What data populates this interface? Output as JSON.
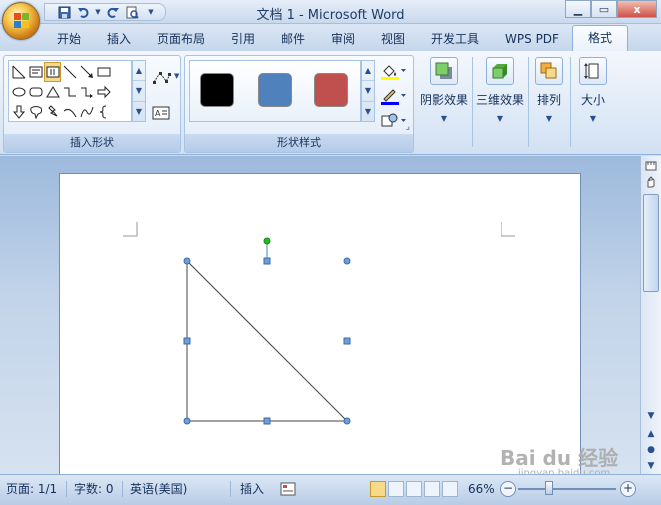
{
  "window": {
    "title": "文档 1 - Microsoft Word",
    "minimize_icon": "minimize-icon",
    "maximize_icon": "maximize-icon",
    "close_label": "x"
  },
  "quick_access": {
    "items": [
      "save-icon",
      "undo-icon",
      "redo-icon",
      "print-preview-icon",
      "customize-dropdown-icon"
    ]
  },
  "tabs": [
    {
      "label": "开始",
      "active": false
    },
    {
      "label": "插入",
      "active": false
    },
    {
      "label": "页面布局",
      "active": false
    },
    {
      "label": "引用",
      "active": false
    },
    {
      "label": "邮件",
      "active": false
    },
    {
      "label": "审阅",
      "active": false
    },
    {
      "label": "视图",
      "active": false
    },
    {
      "label": "开发工具",
      "active": false
    },
    {
      "label": "WPS PDF",
      "active": false
    },
    {
      "label": "格式",
      "active": true
    }
  ],
  "ribbon": {
    "insert_shapes": {
      "label": "插入形状",
      "shapes": [
        "line",
        "textbox",
        "vertical-textbox",
        "line",
        "arrow",
        "rectangle",
        "oval",
        "rounded-rectangle",
        "triangle",
        "elbow-connector",
        "elbow-arrow",
        "right-arrow",
        "down-arrow",
        "callout",
        "lightning",
        "arc",
        "curve",
        "brace"
      ]
    },
    "shape_styles": {
      "label": "形状样式",
      "swatches": [
        "#000000",
        "#4f81bd",
        "#c0504d"
      ],
      "fill_color": "#ffff00",
      "line_color": "#0000ff"
    },
    "shadow_effects": {
      "label": "阴影效果"
    },
    "effects_3d": {
      "label": "三维效果"
    },
    "arrange": {
      "label": "排列"
    },
    "size": {
      "label": "大小"
    }
  },
  "status": {
    "page": "页面: 1/1",
    "words": "字数: 0",
    "language": "英语(美国)",
    "mode": "插入",
    "zoom": "66%",
    "zoom_out": "−",
    "zoom_in": "+"
  },
  "watermark": {
    "text": "Bai du 经验",
    "url": "jingyan.baidu.com"
  },
  "colors": {
    "accent": "#4f81bd",
    "selection_handle": "#4f81bd",
    "rotate_handle": "#22bb22"
  }
}
